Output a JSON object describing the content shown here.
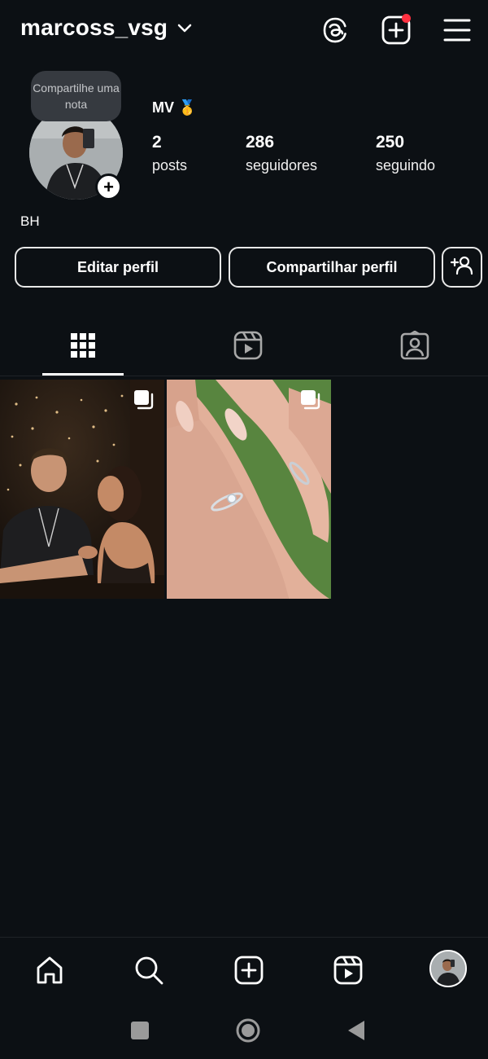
{
  "header": {
    "username": "marcoss_vsg",
    "icons": [
      "chevron-down-icon",
      "threads-icon",
      "new-post-icon",
      "menu-icon"
    ],
    "notification_color": "#ff3040"
  },
  "profile": {
    "note_prompt": "Compartilhe uma nota",
    "display_name": "MV 🥇",
    "stats": {
      "posts": {
        "count": "2",
        "label": "posts"
      },
      "followers": {
        "count": "286",
        "label": "seguidores"
      },
      "following": {
        "count": "250",
        "label": "seguindo"
      }
    },
    "bio": "BH"
  },
  "actions": {
    "edit_label": "Editar perfil",
    "share_label": "Compartilhar perfil"
  },
  "tabs": [
    "grid-icon",
    "reels-icon",
    "tagged-icon"
  ],
  "posts": [
    {
      "type": "carousel",
      "icon": "multiple-photos-icon"
    },
    {
      "type": "carousel",
      "icon": "multiple-photos-icon"
    }
  ],
  "bottom_nav": [
    "home-icon",
    "search-icon",
    "create-icon",
    "reels-icon",
    "profile-avatar"
  ],
  "system_nav": [
    "recents-icon",
    "home-icon",
    "back-icon"
  ],
  "colors": {
    "background": "#0c1014",
    "text": "#f5f5f5",
    "note_bubble": "#363a40"
  }
}
